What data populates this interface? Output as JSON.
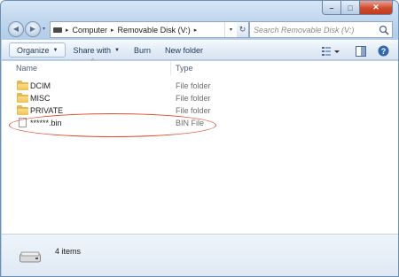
{
  "window": {
    "caption_buttons": {
      "minimize": "–",
      "maximize": "□",
      "close": "✕"
    }
  },
  "nav": {
    "back_glyph": "◀",
    "forward_glyph": "▶",
    "history_glyph": "▾"
  },
  "address": {
    "prefix_separator": "▸",
    "crumbs": [
      "Computer",
      "Removable Disk (V:)"
    ],
    "separator": "▸",
    "dropdown_glyph": "▾"
  },
  "refresh_glyph": "↻",
  "search": {
    "placeholder": "Search Removable Disk (V:)"
  },
  "toolbar": {
    "organize_label": "Organize",
    "organize_caret": "▼",
    "share_label": "Share with",
    "share_caret": "▼",
    "burn_label": "Burn",
    "new_folder_label": "New folder"
  },
  "columns": {
    "name": "Name",
    "type": "Type",
    "sort_glyph": "^"
  },
  "files": [
    {
      "name": "DCIM",
      "type": "File folder",
      "icon": "folder-icon"
    },
    {
      "name": "MISC",
      "type": "File folder",
      "icon": "folder-icon"
    },
    {
      "name": "PRIVATE",
      "type": "File folder",
      "icon": "folder-icon"
    },
    {
      "name": "******.bin",
      "type": "BIN File",
      "icon": "file-icon"
    }
  ],
  "status": {
    "item_count": "4 items"
  },
  "colors": {
    "window_frame": "#b9d1ea",
    "highlight": "#e04e2a",
    "folder": "#e7b84a"
  }
}
